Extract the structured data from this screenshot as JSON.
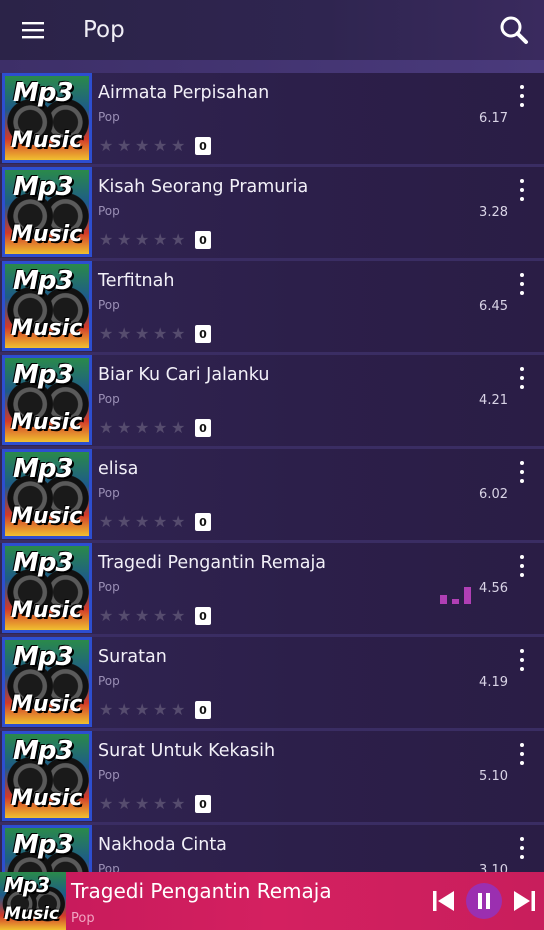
{
  "app_bar": {
    "title": "Pop",
    "menu_icon": "hamburger-menu-icon",
    "search_icon": "search-icon"
  },
  "colors": {
    "accent": "#d42060",
    "play_button": "#9b2fb0",
    "equalizer": "#b03fb5",
    "thumb_border": "#2d4ed0"
  },
  "thumb": {
    "line1": "Mp3",
    "line2": "Music"
  },
  "songs": [
    {
      "title": "Airmata Perpisahan",
      "genre": "Pop",
      "duration": "6.17",
      "rating_count": "0",
      "playing": false
    },
    {
      "title": "Kisah Seorang Pramuria",
      "genre": "Pop",
      "duration": "3.28",
      "rating_count": "0",
      "playing": false
    },
    {
      "title": "Terfitnah",
      "genre": "Pop",
      "duration": "6.45",
      "rating_count": "0",
      "playing": false
    },
    {
      "title": "Biar Ku Cari Jalanku",
      "genre": "Pop",
      "duration": "4.21",
      "rating_count": "0",
      "playing": false
    },
    {
      "title": "elisa",
      "genre": "Pop",
      "duration": "6.02",
      "rating_count": "0",
      "playing": false
    },
    {
      "title": "Tragedi Pengantin Remaja",
      "genre": "Pop",
      "duration": "4.56",
      "rating_count": "0",
      "playing": true
    },
    {
      "title": "Suratan",
      "genre": "Pop",
      "duration": "4.19",
      "rating_count": "0",
      "playing": false
    },
    {
      "title": "Surat Untuk Kekasih",
      "genre": "Pop",
      "duration": "5.10",
      "rating_count": "0",
      "playing": false
    },
    {
      "title": "Nakhoda Cinta",
      "genre": "Pop",
      "duration": "3.10",
      "rating_count": "0",
      "playing": false
    }
  ],
  "now_playing": {
    "title": "Tragedi Pengantin Remaja",
    "genre": "Pop",
    "controls": [
      "skip-previous-icon",
      "pause-icon",
      "skip-next-icon"
    ]
  }
}
